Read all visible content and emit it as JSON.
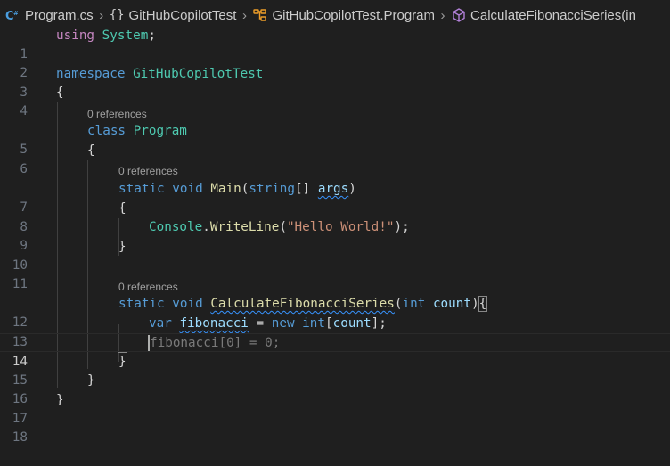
{
  "breadcrumb": {
    "file": "Program.cs",
    "namespace_icon": "{}",
    "namespace": "GitHubCopilotTest",
    "class": "GitHubCopilotTest.Program",
    "method": "CalculateFibonacciSeries(in"
  },
  "icons": {
    "file": "csharp-file-icon",
    "namespace": "namespace-braces-icon",
    "class": "class-icon",
    "method": "method-cube-icon",
    "separator": "chevron-right-icon"
  },
  "colors": {
    "background": "#1f1f1f",
    "keyword": "#569cd6",
    "control_keyword": "#c586c0",
    "type": "#4ec9b0",
    "function": "#dcdcaa",
    "variable": "#9cdcfe",
    "string": "#ce9178",
    "ghost_text": "#7a7a7a",
    "line_number": "#6e7681",
    "squiggle": "#3794ff",
    "csharp_icon": "#4a9ee0",
    "class_icon": "#ee9d28",
    "method_icon": "#b180d7"
  },
  "codelens": {
    "program": "0 references",
    "main": "0 references",
    "calc": "0 references"
  },
  "line_numbers": [
    "1",
    "2",
    "3",
    "4",
    "5",
    "6",
    "7",
    "8",
    "9",
    "10",
    "11",
    "12",
    "13",
    "14",
    "15",
    "16",
    "17",
    "18"
  ],
  "active_line": 14,
  "code": {
    "l1_kw": "using",
    "l1_ns": "System",
    "l1_semi": ";",
    "l3_kw": "namespace",
    "l3_name": "GitHubCopilotTest",
    "open_brace": "{",
    "close_brace": "}",
    "l5_kw": "class",
    "l5_name": "Program",
    "l7_static": "static",
    "l7_void": "void",
    "l7_fn": "Main",
    "l7_open": "(",
    "l7_type": "string",
    "l7_arr": "[]",
    "l7_param": "args",
    "l7_close": ")",
    "l9_class": "Console",
    "l9_dot": ".",
    "l9_fn": "WriteLine",
    "l9_open": "(",
    "l9_str": "\"Hello World!\"",
    "l9_close": ");",
    "l12_static": "static",
    "l12_void": "void",
    "l12_fn": "CalculateFibonacciSeries",
    "l12_open": "(",
    "l12_int": "int",
    "l12_param": "count",
    "l12_close": ")",
    "l13_var": "var",
    "l13_name": "fibonacci",
    "l13_eq": " = ",
    "l13_new": "new",
    "l13_int": "int",
    "l13_ob": "[",
    "l13_count": "count",
    "l13_cb": "];",
    "l14_ghost": "fibonacci[0] = 0;"
  }
}
